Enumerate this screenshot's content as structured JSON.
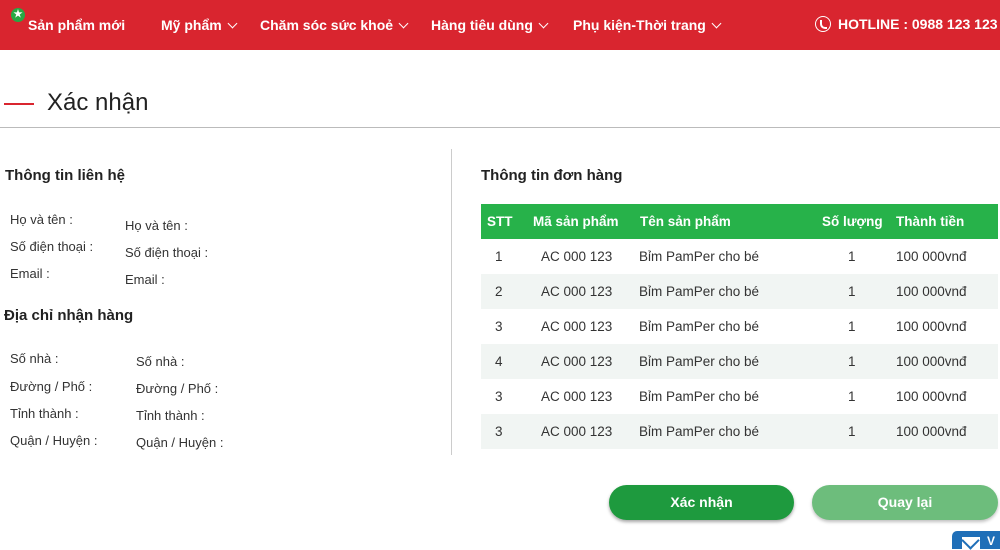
{
  "nav": {
    "new_products": "Sản phẩm mới",
    "items": [
      "Mỹ phẩm",
      "Chăm sóc sức khoẻ",
      "Hàng tiêu dùng",
      "Phụ kiện-Thời trang"
    ],
    "hotline": "HOTLINE : 0988 123 123",
    "star_icon": "★"
  },
  "page_title": "Xác nhận",
  "contact": {
    "heading": "Thông tin liên hệ",
    "labels": [
      "Họ và tên :",
      "Số điện thoại :",
      "Email :"
    ],
    "values": [
      "Họ và tên :",
      "Số điện thoại :",
      "Email :"
    ]
  },
  "address": {
    "heading": "Địa chỉ nhận hàng",
    "labels": [
      "Số nhà :",
      "Đường / Phố :",
      "Tỉnh thành :",
      "Quận / Huyện :"
    ],
    "values": [
      "Số nhà :",
      "Đường / Phố :",
      "Tỉnh thành :",
      "Quận / Huyện :"
    ]
  },
  "order": {
    "heading": "Thông tin đơn hàng",
    "columns": [
      "STT",
      "Mã sản phẩm",
      "Tên sản phẩm",
      "Số lượng",
      "Thành tiền"
    ],
    "rows": [
      [
        "1",
        "AC 000 123",
        "Bỉm PamPer cho bé",
        "1",
        "100 000vnđ"
      ],
      [
        "2",
        "AC 000 123",
        "Bỉm PamPer cho bé",
        "1",
        "100 000vnđ"
      ],
      [
        "3",
        "AC 000 123",
        "Bỉm PamPer cho bé",
        "1",
        "100 000vnđ"
      ],
      [
        "4",
        "AC 000 123",
        "Bỉm PamPer cho bé",
        "1",
        "100 000vnđ"
      ],
      [
        "3",
        "AC 000 123",
        "Bỉm PamPer cho bé",
        "1",
        "100 000vnđ"
      ],
      [
        "3",
        "AC 000 123",
        "Bỉm PamPer cho bé",
        "1",
        "100 000vnđ"
      ]
    ]
  },
  "buttons": {
    "confirm": "Xác nhận",
    "back": "Quay lại"
  },
  "chat": {
    "label": "V"
  },
  "colors": {
    "brand_red": "#d9252f",
    "green": "#27b24a",
    "button_dark_green": "#1e9a3e",
    "button_light_green": "#6dbd7c",
    "chat_blue": "#1f6fb8"
  }
}
